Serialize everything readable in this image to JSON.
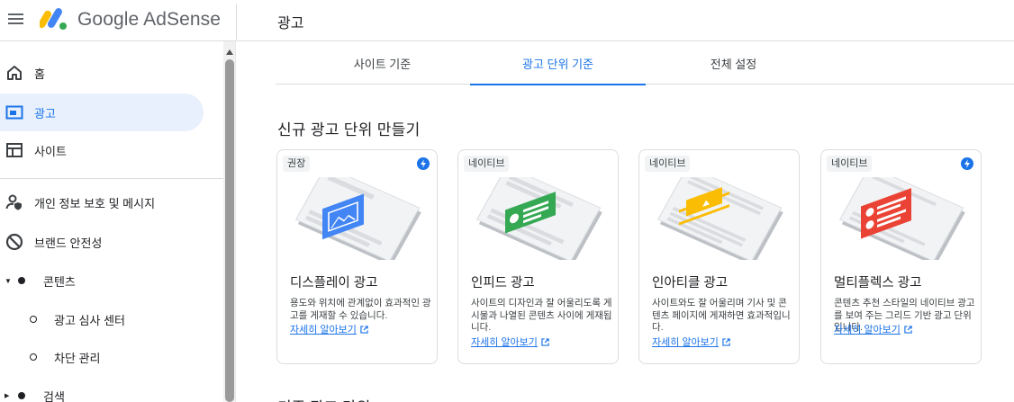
{
  "app": {
    "brand": "Google AdSense",
    "page_title": "광고"
  },
  "sidebar": {
    "items": [
      {
        "label": "홈"
      },
      {
        "label": "광고"
      },
      {
        "label": "사이트"
      },
      {
        "label": "개인 정보 보호 및 메시지"
      },
      {
        "label": "브랜드 안전성"
      },
      {
        "label": "콘텐츠"
      },
      {
        "label": "광고 심사 센터"
      },
      {
        "label": "차단 관리"
      },
      {
        "label": "검색"
      }
    ]
  },
  "tabs": [
    {
      "label": "사이트 기준"
    },
    {
      "label": "광고 단위 기준"
    },
    {
      "label": "전체 설정"
    }
  ],
  "section": {
    "title": "신규 광고 단위 만들기",
    "next_title": "기존 광고 단위"
  },
  "cards": [
    {
      "badge": "권장",
      "title": "디스플레이 광고",
      "desc": "용도와 위치에 관계없이 효과적인 광고를 게재할 수 있습니다.",
      "link": "자세히 알아보기",
      "accent": "#4285f4"
    },
    {
      "badge": "네이티브",
      "title": "인피드 광고",
      "desc": "사이트의 디자인과 잘 어울리도록 게시물과 나열된 콘텐츠 사이에 게재됩니다.",
      "link": "자세히 알아보기",
      "accent": "#34a853"
    },
    {
      "badge": "네이티브",
      "title": "인아티클 광고",
      "desc": "사이트와도 잘 어울리며 기사 및 콘텐츠 페이지에 게재하면 효과적입니다.",
      "link": "자세히 알아보기",
      "accent": "#fbbc04"
    },
    {
      "badge": "네이티브",
      "title": "멀티플렉스 광고",
      "desc": "콘텐츠 추천 스타일의 네이티브 광고를 보여 주는 그리드 기반 광고 단위입니다.",
      "link": "자세히 알아보기",
      "accent": "#ea4335"
    }
  ],
  "colors": {
    "primary": "#1a73e8",
    "active_bg": "#e8f0fe"
  }
}
